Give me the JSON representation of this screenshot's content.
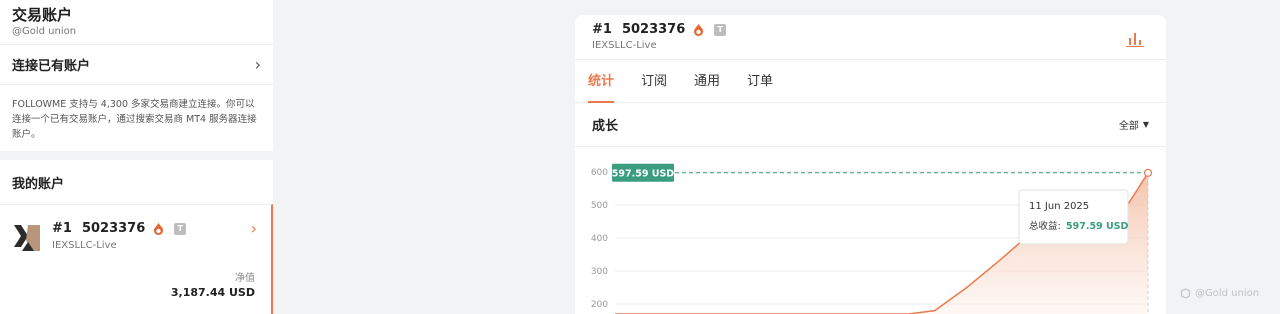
{
  "sidebar": {
    "account_title": "交易账户",
    "account_handle": "@Gold union",
    "connect_label": "连接已有账户",
    "info_text": "FOLLOWME 支持与 4,300 多家交易商建立连接。你可以连接一个已有交易账户，通过搜索交易商 MT4 服务器连接账户。",
    "my_accounts_title": "我的账户",
    "account_row": {
      "rank": "#1",
      "number": "5023376",
      "badge": "T",
      "broker": "IEXSLLC-Live",
      "equity_label": "净值",
      "equity_value": "3,187.44 USD"
    }
  },
  "panel": {
    "rank": "#1",
    "number": "5023376",
    "badge": "T",
    "broker": "IEXSLLC-Live",
    "tabs": [
      {
        "label": "统计",
        "active": true
      },
      {
        "label": "订阅",
        "active": false
      },
      {
        "label": "通用",
        "active": false
      },
      {
        "label": "订单",
        "active": false
      }
    ],
    "section_title": "成长",
    "range_select": "全部"
  },
  "chart_data": {
    "type": "area",
    "y_ticks": [
      "600",
      "500",
      "400",
      "300",
      "200"
    ],
    "ylim": [
      150,
      640
    ],
    "current_label": "597.59 USD",
    "current_value": 597.59,
    "x": [
      0,
      0.55,
      0.6,
      0.66,
      0.72,
      0.77,
      0.81,
      0.86,
      0.9,
      0.95,
      1.0
    ],
    "values": [
      150,
      150,
      180,
      250,
      330,
      400,
      430,
      410,
      415,
      470,
      597.59
    ],
    "tooltip": {
      "date": "11 Jun 2025",
      "label": "总收益:",
      "value": "597.59 USD"
    },
    "colors": {
      "line": "#e97b4e",
      "marker": "#3a9e7e",
      "fill_top": "#f3b89c",
      "fill_bottom": "#fdf0ea"
    }
  },
  "watermark": "@Gold union"
}
